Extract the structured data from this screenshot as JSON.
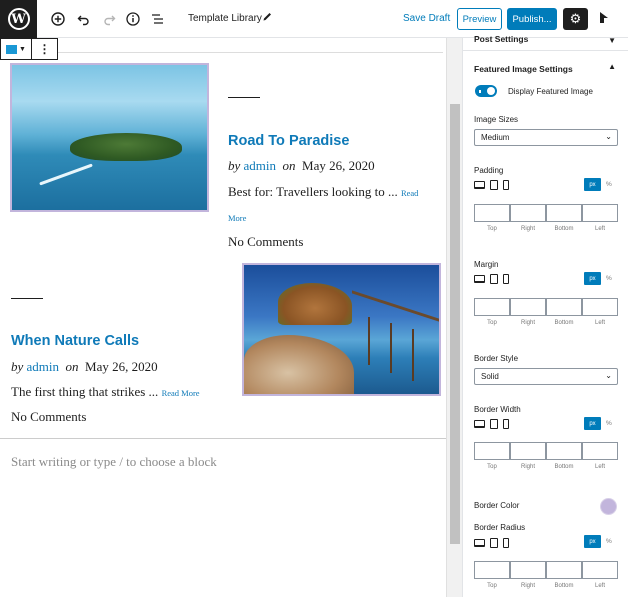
{
  "topbar": {
    "add_icon": "plus-circle-icon",
    "undo_icon": "undo-icon",
    "redo_icon": "redo-icon",
    "info_icon": "info-icon",
    "outline_icon": "list-view-icon",
    "title": "Template Library",
    "save_draft": "Save Draft",
    "preview": "Preview",
    "publish": "Publish...",
    "settings_icon": "gear-icon",
    "plugin_icon": "plugin-icon"
  },
  "posts": [
    {
      "title": "Road To Paradise",
      "by": "by",
      "author": "admin",
      "on": "on",
      "date": "May 26, 2020",
      "excerpt": "Best for: Travellers looking to ...",
      "read_more_1": "Read",
      "read_more_2": "More",
      "comments": "No Comments"
    },
    {
      "title": "When Nature Calls",
      "by": "by",
      "author": "admin",
      "on": "on",
      "date": "May 26, 2020",
      "excerpt": "The first thing that strikes ...",
      "read_more": "Read More",
      "comments": "No Comments"
    }
  ],
  "editor": {
    "placeholder": "Start writing or type / to choose a block"
  },
  "sidebar": {
    "post_settings": "Post Settings",
    "featured_image_settings": "Featured Image Settings",
    "display_featured_image": "Display Featured Image",
    "display_featured_image_on": true,
    "image_sizes_label": "Image Sizes",
    "image_sizes_value": "Medium",
    "padding_label": "Padding",
    "margin_label": "Margin",
    "border_style_label": "Border Style",
    "border_style_value": "Solid",
    "border_width_label": "Border Width",
    "border_color_label": "Border Color",
    "border_color": "#c2b5dc",
    "border_radius_label": "Border Radius",
    "unit_px": "px",
    "unit_pct": "%",
    "box_labels": [
      "Top",
      "Right",
      "Bottom",
      "Left"
    ]
  }
}
